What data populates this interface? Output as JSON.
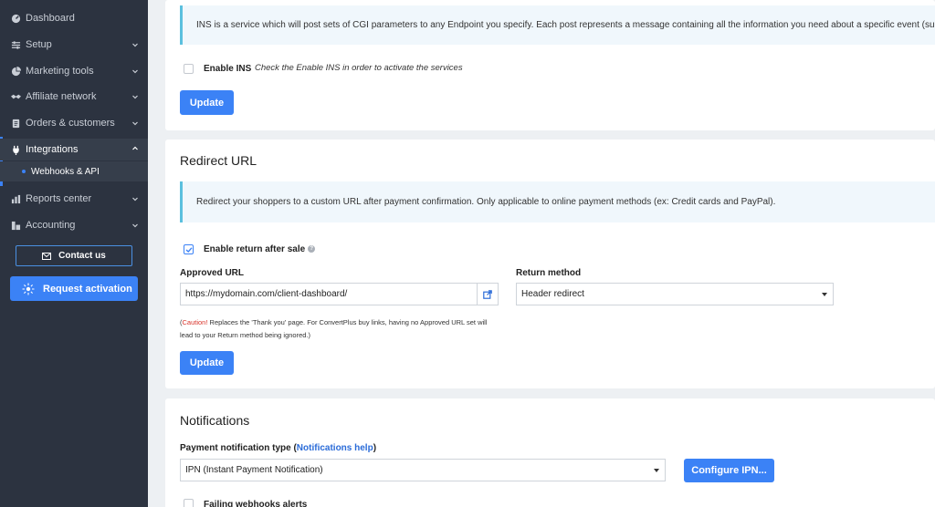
{
  "sidebar": {
    "items": [
      {
        "label": "Dashboard",
        "icon": "dashboard-icon"
      },
      {
        "label": "Setup",
        "icon": "setup-icon"
      },
      {
        "label": "Marketing tools",
        "icon": "pie-chart-icon"
      },
      {
        "label": "Affiliate network",
        "icon": "handshake-icon"
      },
      {
        "label": "Orders & customers",
        "icon": "orders-icon"
      },
      {
        "label": "Integrations",
        "icon": "plug-icon"
      },
      {
        "label": "Reports center",
        "icon": "bar-chart-icon"
      },
      {
        "label": "Accounting",
        "icon": "accounting-icon"
      }
    ],
    "sub_item": "Webhooks & API",
    "contact_label": "Contact us",
    "activation_label": "Request activation"
  },
  "ins": {
    "info": "INS is a service which will post sets of CGI parameters to any Endpoint you specify. Each post represents a message containing all the information you need about a specific event (such as whe",
    "enable_label": "Enable INS",
    "enable_note": "Check the Enable INS in order to activate the services",
    "enable_checked": false,
    "update_label": "Update"
  },
  "redirect": {
    "title": "Redirect URL",
    "info": "Redirect your shoppers to a custom URL after payment confirmation. Only applicable to online payment methods (ex: Credit cards and PayPal).",
    "enable_label": "Enable return after sale",
    "enable_checked": true,
    "approved_url_label": "Approved URL",
    "approved_url_value": "https://mydomain.com/client-dashboard/",
    "return_method_label": "Return method",
    "return_method_value": "Header redirect",
    "caution_word": "Caution!",
    "caution_text": " Replaces the 'Thank you' page. For ConvertPlus buy links, having no Approved URL set will lead to your Return method being ignored.)",
    "caution_open": "(",
    "update_label": "Update"
  },
  "notifications": {
    "title": "Notifications",
    "type_label_prefix": "Payment notification type (",
    "type_label_link": "Notifications help",
    "type_label_suffix": ")",
    "type_value": "IPN (Instant Payment Notification)",
    "configure_label": "Configure IPN...",
    "failing_label": "Failing webhooks alerts"
  },
  "colors": {
    "accent": "#3b82f6",
    "sidebar_bg": "#2c3340",
    "info_border": "#5bc0de",
    "caution": "#d9342b"
  }
}
